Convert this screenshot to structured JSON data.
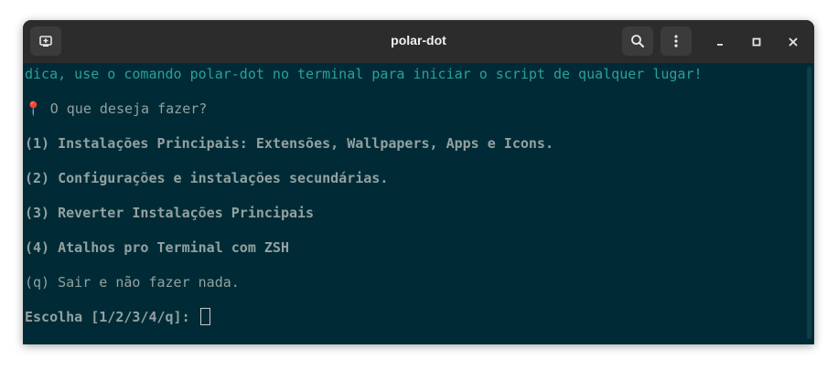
{
  "window": {
    "title": "polar-dot"
  },
  "icons": {
    "new_tab": "new-tab-icon",
    "search": "search-icon",
    "menu": "kebab-menu-icon",
    "minimize": "minimize-icon",
    "maximize": "maximize-icon",
    "close": "close-icon",
    "pin": "round-pushpin-emoji"
  },
  "colors": {
    "terminal_bg": "#002b36",
    "tip_text": "#2aa198",
    "body_text": "#93a1a1",
    "titlebar": "#2c2c2c"
  },
  "terminal": {
    "tip": "dica, use o comando polar-dot no terminal para iniciar o script de qualquer lugar!",
    "question_icon": "📍",
    "question": " O que deseja fazer?",
    "options": [
      "(1) Instalações Principais: Extensões, Wallpapers, Apps e Icons.",
      "(2) Configurações e instalações secundárias.",
      "(3) Reverter Instalações Principais",
      "(4) Atalhos pro Terminal com ZSH",
      "(q) Sair e não fazer nada."
    ],
    "prompt": "Escolha [1/2/3/4/q]: "
  }
}
